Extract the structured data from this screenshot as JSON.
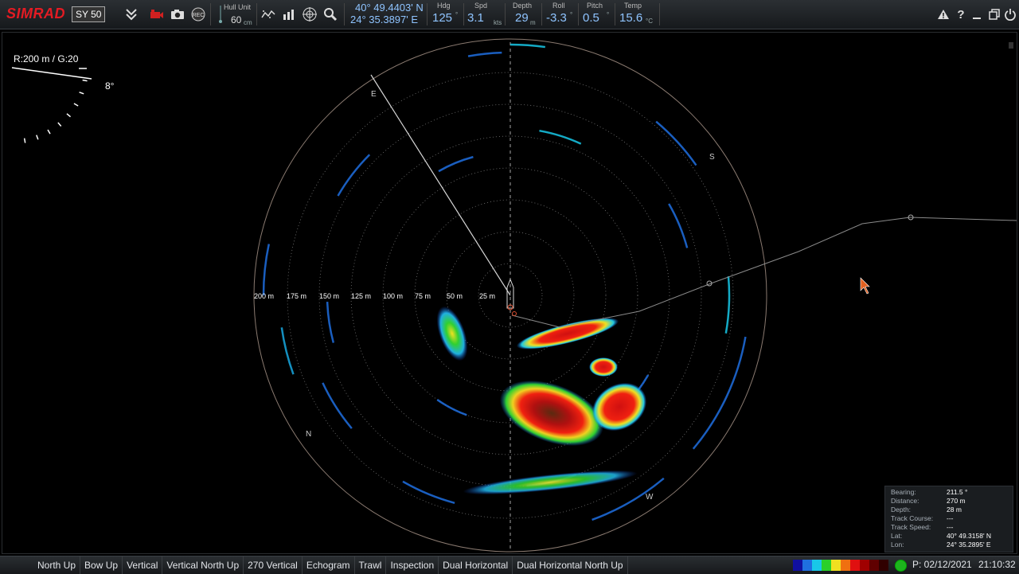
{
  "toolbar": {
    "brand": "SIMRAD",
    "model": "SY 50",
    "hull_unit_label": "Hull Unit",
    "hull_unit_value": "60",
    "hull_unit_unit": "cm",
    "lat": "40° 49.4403' N",
    "lon": "24° 35.3897' E",
    "hdg_label": "Hdg",
    "hdg_value": "125",
    "hdg_unit": "°",
    "spd_label": "Spd",
    "spd_value": "3.1",
    "spd_unit": "kts",
    "depth_label": "Depth",
    "depth_value": "29",
    "depth_unit": "m",
    "roll_label": "Roll",
    "roll_value": "-3.3",
    "roll_unit": "°",
    "pitch_label": "Pitch",
    "pitch_value": "0.5",
    "pitch_unit": "°",
    "temp_label": "Temp",
    "temp_value": "15.6",
    "temp_unit": "°C",
    "icons": [
      "menu-collapse-icon",
      "record-camera-icon",
      "screenshot-icon",
      "rec-icon",
      "hull-unit-icon",
      "colors-icon",
      "chart-icon",
      "target-icon",
      "zoom-icon",
      "alarm-icon",
      "help-icon",
      "minimize-icon",
      "restore-icon",
      "power-icon"
    ],
    "rec_label": "REC"
  },
  "display": {
    "range_gain": "R:200 m  / G:20",
    "tilt": "8°",
    "range_labels": [
      "200 m",
      "175 m",
      "150 m",
      "125 m",
      "100 m",
      "75 m",
      "50 m",
      "25 m"
    ],
    "compass_labels": [
      "E",
      "S",
      "W",
      "N"
    ]
  },
  "info": {
    "rows": [
      {
        "key": "Bearing:",
        "value": "211.5 °"
      },
      {
        "key": "Distance:",
        "value": "270 m"
      },
      {
        "key": "Depth:",
        "value": "28 m"
      },
      {
        "key": "Track Course:",
        "value": "---"
      },
      {
        "key": "Track Speed:",
        "value": "---"
      },
      {
        "key": "Lat:",
        "value": "40° 49.3158' N"
      },
      {
        "key": "Lon:",
        "value": "24° 35.2895' E"
      }
    ]
  },
  "bottom": {
    "modes": [
      "North Up",
      "Bow Up",
      "Vertical",
      "Vertical North Up",
      "270 Vertical",
      "Echogram",
      "Trawl",
      "Inspection",
      "Dual Horizontal",
      "Dual Horizontal North Up"
    ],
    "colors": [
      "#1010a0",
      "#1f6fe0",
      "#18c8e8",
      "#2ad02a",
      "#f0e020",
      "#f07010",
      "#e01010",
      "#a00000",
      "#600000",
      "#300000"
    ],
    "date": "P: 02/12/2021",
    "time": "21:10:32",
    "status_color": "#1db41d"
  }
}
